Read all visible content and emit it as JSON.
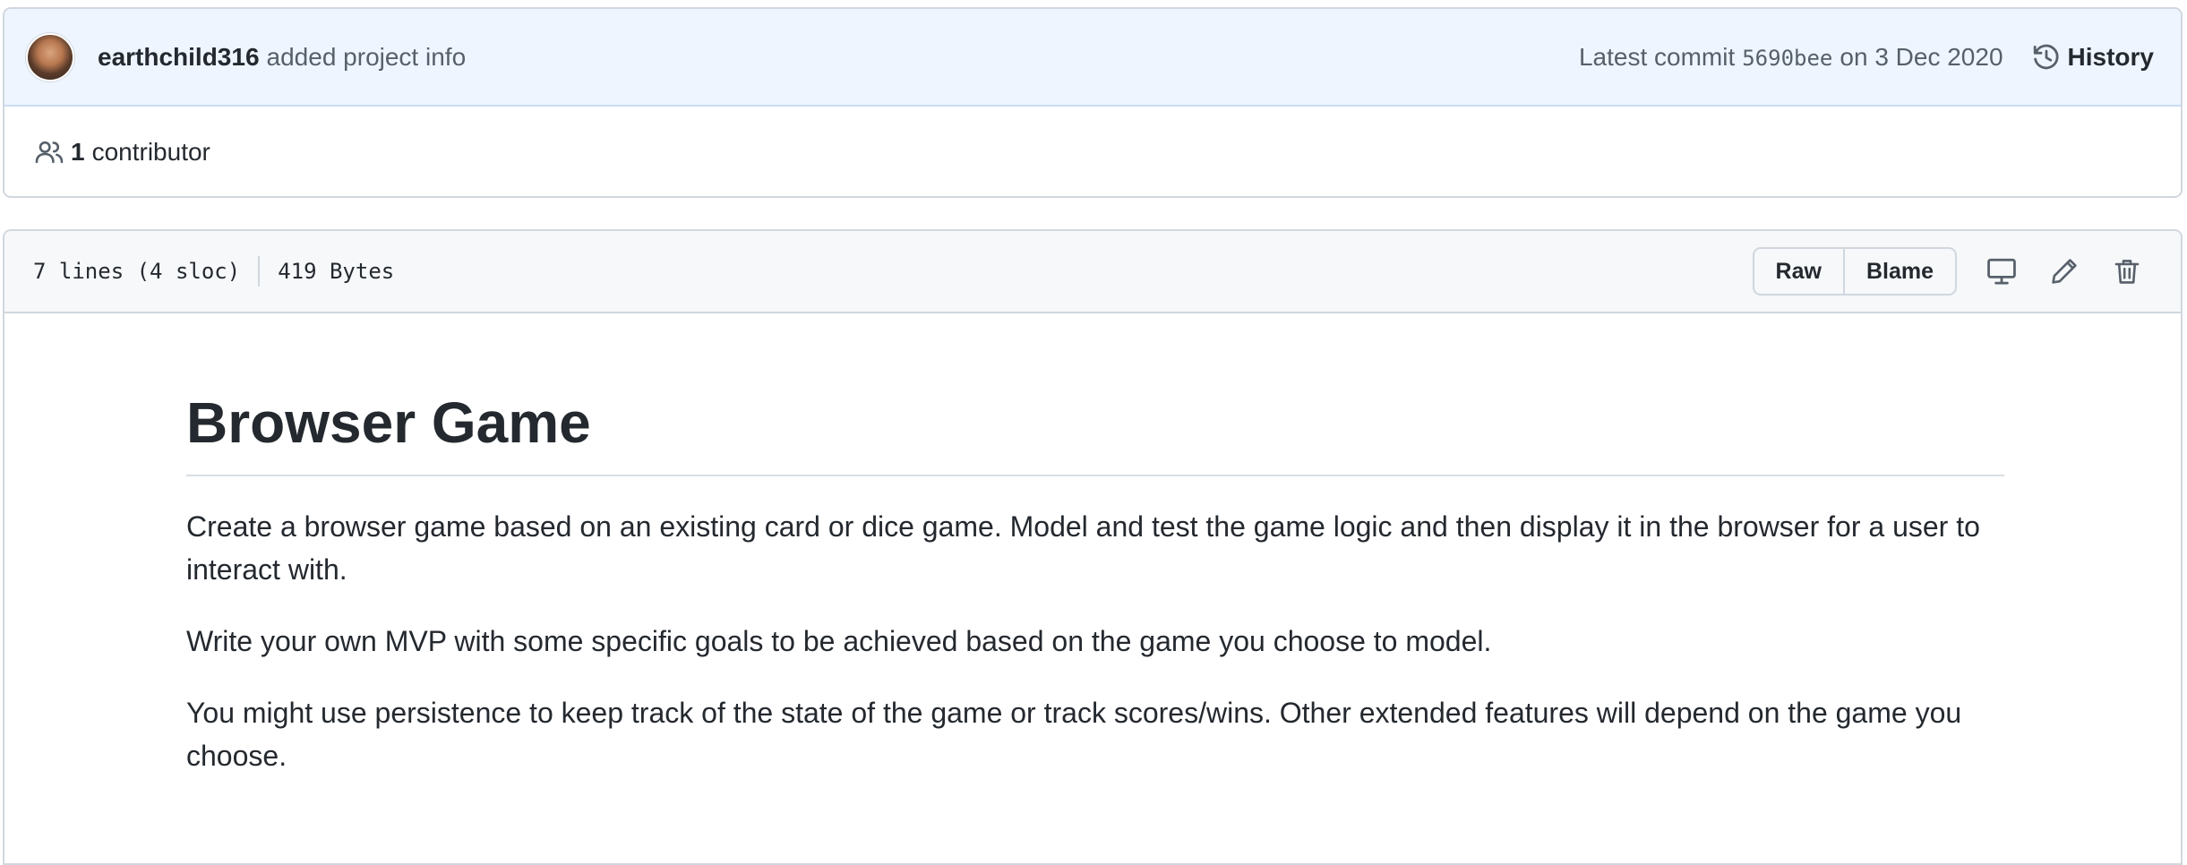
{
  "commit": {
    "author": "earthchild316",
    "message": "added project info",
    "latest_label": "Latest commit",
    "sha": "5690bee",
    "date": "on 3 Dec 2020",
    "history_label": "History"
  },
  "contributors": {
    "count": "1",
    "label": "contributor"
  },
  "file": {
    "lines": "7 lines (4 sloc)",
    "size": "419 Bytes",
    "raw_label": "Raw",
    "blame_label": "Blame",
    "icons": [
      "display-icon",
      "pencil-icon",
      "trash-icon"
    ]
  },
  "readme": {
    "title": "Browser Game",
    "paragraphs": [
      "Create a browser game based on an existing card or dice game. Model and test the game logic and then display it in the browser for a user to interact with.",
      "Write your own MVP with some specific goals to be achieved based on the game you choose to model.",
      "You might use persistence to keep track of the state of the game or track scores/wins. Other extended features will depend on the game you choose."
    ]
  },
  "colors": {
    "header_bg": "#eef5ff",
    "file_header_bg": "#f6f8fa",
    "border": "#d0d7de",
    "text": "#24292f",
    "muted": "#57606a"
  }
}
